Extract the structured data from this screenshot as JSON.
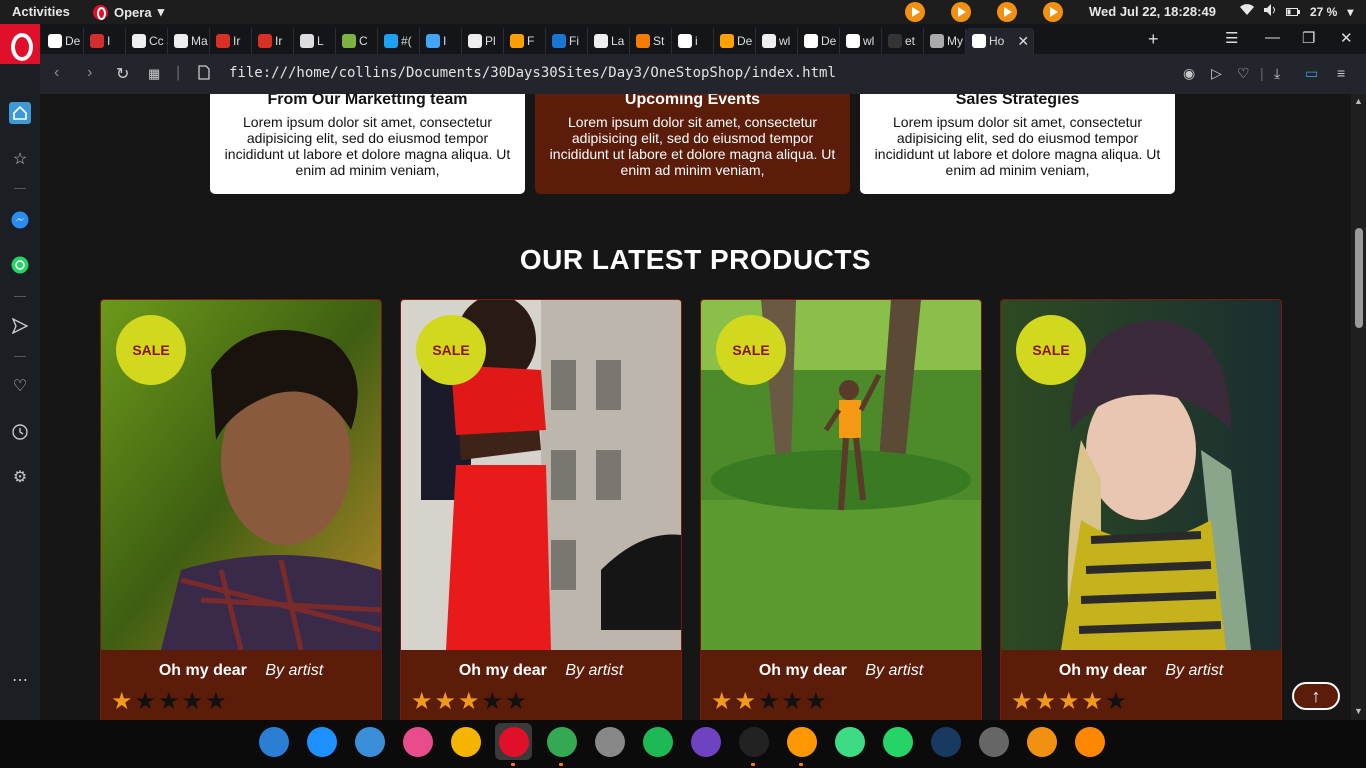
{
  "topbar": {
    "activities": "Activities",
    "app_name": "Opera",
    "app_menu_arrow": "▾",
    "clock": "Wed Jul 22, 18:28:49",
    "battery": "27 %"
  },
  "tabs": [
    {
      "label": "De",
      "favicon_color": "#ffffff",
      "icon": "codepen-icon"
    },
    {
      "label": "I",
      "favicon_color": "#d32f2f",
      "icon": "angular-icon"
    },
    {
      "label": "Cc",
      "favicon_color": "#eeeeee",
      "icon": "github-icon"
    },
    {
      "label": "Ma",
      "favicon_color": "#eeeeee",
      "icon": "github-icon"
    },
    {
      "label": "Ir",
      "favicon_color": "#d93025",
      "icon": "gmail-icon"
    },
    {
      "label": "Ir",
      "favicon_color": "#d93025",
      "icon": "gmail-icon"
    },
    {
      "label": "L",
      "favicon_color": "#dddddd",
      "icon": "linkedin-icon"
    },
    {
      "label": "C",
      "favicon_color": "#7cb342",
      "icon": "css-icon"
    },
    {
      "label": "#(",
      "favicon_color": "#1da1f2",
      "icon": "twitter-icon"
    },
    {
      "label": "I",
      "favicon_color": "#42a5f5",
      "icon": "person-icon"
    },
    {
      "label": "Pl",
      "favicon_color": "#eeeeee",
      "icon": "cb-icon"
    },
    {
      "label": "F",
      "favicon_color": "#ffa000",
      "icon": "firebase-icon"
    },
    {
      "label": "Fi",
      "favicon_color": "#1976d2",
      "icon": "freecodecamp-icon"
    },
    {
      "label": "La",
      "favicon_color": "#eeeeee",
      "icon": "document-icon"
    },
    {
      "label": "St",
      "favicon_color": "#f57c00",
      "icon": "stackoverflow-icon"
    },
    {
      "label": "i",
      "favicon_color": "#ffffff",
      "icon": "google-icon"
    },
    {
      "label": "De",
      "favicon_color": "#ffa000",
      "icon": "firebase-icon"
    },
    {
      "label": "wl",
      "favicon_color": "#eeeeee",
      "icon": "document-icon"
    },
    {
      "label": "De",
      "favicon_color": "#ffffff",
      "icon": "codepen-icon"
    },
    {
      "label": "wl",
      "favicon_color": "#ffffff",
      "icon": "google-icon"
    },
    {
      "label": "et",
      "favicon_color": "#333333",
      "icon": "dev-icon"
    },
    {
      "label": "My",
      "favicon_color": "#aaaaaa",
      "icon": "person-icon"
    },
    {
      "label": "Ho",
      "favicon_color": "#ffffff",
      "icon": "cb-icon",
      "active": true
    }
  ],
  "address": {
    "url": "file:///home/collins/Documents/30Days30Sites/Day3/OneStopShop/index.html"
  },
  "info_cards": [
    {
      "title": "From Our Marketting team",
      "text": "Lorem ipsum dolor sit amet, consectetur adipisicing elit, sed do eiusmod tempor incididunt ut labore et dolore magna aliqua. Ut enim ad minim veniam,",
      "dark": false
    },
    {
      "title": "Upcoming Events",
      "text": "Lorem ipsum dolor sit amet, consectetur adipisicing elit, sed do eiusmod tempor incididunt ut labore et dolore magna aliqua. Ut enim ad minim veniam,",
      "dark": true
    },
    {
      "title": "Sales Strategies",
      "text": "Lorem ipsum dolor sit amet, consectetur adipisicing elit, sed do eiusmod tempor incididunt ut labore et dolore magna aliqua. Ut enim ad minim veniam,",
      "dark": false
    }
  ],
  "section_title": "OUR LATEST PRODUCTS",
  "products": [
    {
      "badge": "SALE",
      "name": "Oh my dear",
      "artist": "By artist",
      "rating": 1,
      "max_rating": 5
    },
    {
      "badge": "SALE",
      "name": "Oh my dear",
      "artist": "By artist",
      "rating": 3,
      "max_rating": 5
    },
    {
      "badge": "SALE",
      "name": "Oh my dear",
      "artist": "By artist",
      "rating": 2,
      "max_rating": 5
    },
    {
      "badge": "SALE",
      "name": "Oh my dear",
      "artist": "By artist",
      "rating": 4,
      "max_rating": 5
    }
  ],
  "scroll_top_icon": "arrow-up-icon",
  "colors": {
    "accent_dark_red": "#5c1c0a",
    "sale_badge": "#d2d81d",
    "sale_text": "#8b1208",
    "star_on": "#f09a1a",
    "opera_red": "#e0102b"
  },
  "dock": [
    {
      "name": "finder-icon",
      "color": "#2a7fd4",
      "running": false
    },
    {
      "name": "app-store-icon",
      "color": "#1e90ff",
      "running": false
    },
    {
      "name": "safari-icon",
      "color": "#3b8fd9",
      "running": false
    },
    {
      "name": "itunes-icon",
      "color": "#e84c8b",
      "running": false
    },
    {
      "name": "photos-icon",
      "color": "#f4b400",
      "running": false
    },
    {
      "name": "opera-icon",
      "color": "#e0102b",
      "running": true,
      "active": true
    },
    {
      "name": "chrome-icon",
      "color": "#34a853",
      "running": true
    },
    {
      "name": "settings-icon",
      "color": "#888888",
      "running": false
    },
    {
      "name": "spotify-icon",
      "color": "#1db954",
      "running": false
    },
    {
      "name": "github-desktop-icon",
      "color": "#6f42c1",
      "running": false
    },
    {
      "name": "terminal-icon",
      "color": "#222222",
      "running": true
    },
    {
      "name": "sublime-icon",
      "color": "#ff9800",
      "running": true
    },
    {
      "name": "android-studio-icon",
      "color": "#3ddc84",
      "running": false
    },
    {
      "name": "whatsapp-icon",
      "color": "#25d366",
      "running": false
    },
    {
      "name": "virtualbox-icon",
      "color": "#183a61",
      "running": false
    },
    {
      "name": "trucks-icon",
      "color": "#666666",
      "running": false
    },
    {
      "name": "plex-icon",
      "color": "#f29111",
      "running": false
    },
    {
      "name": "vlc-icon",
      "color": "#ff8800",
      "running": false
    }
  ]
}
